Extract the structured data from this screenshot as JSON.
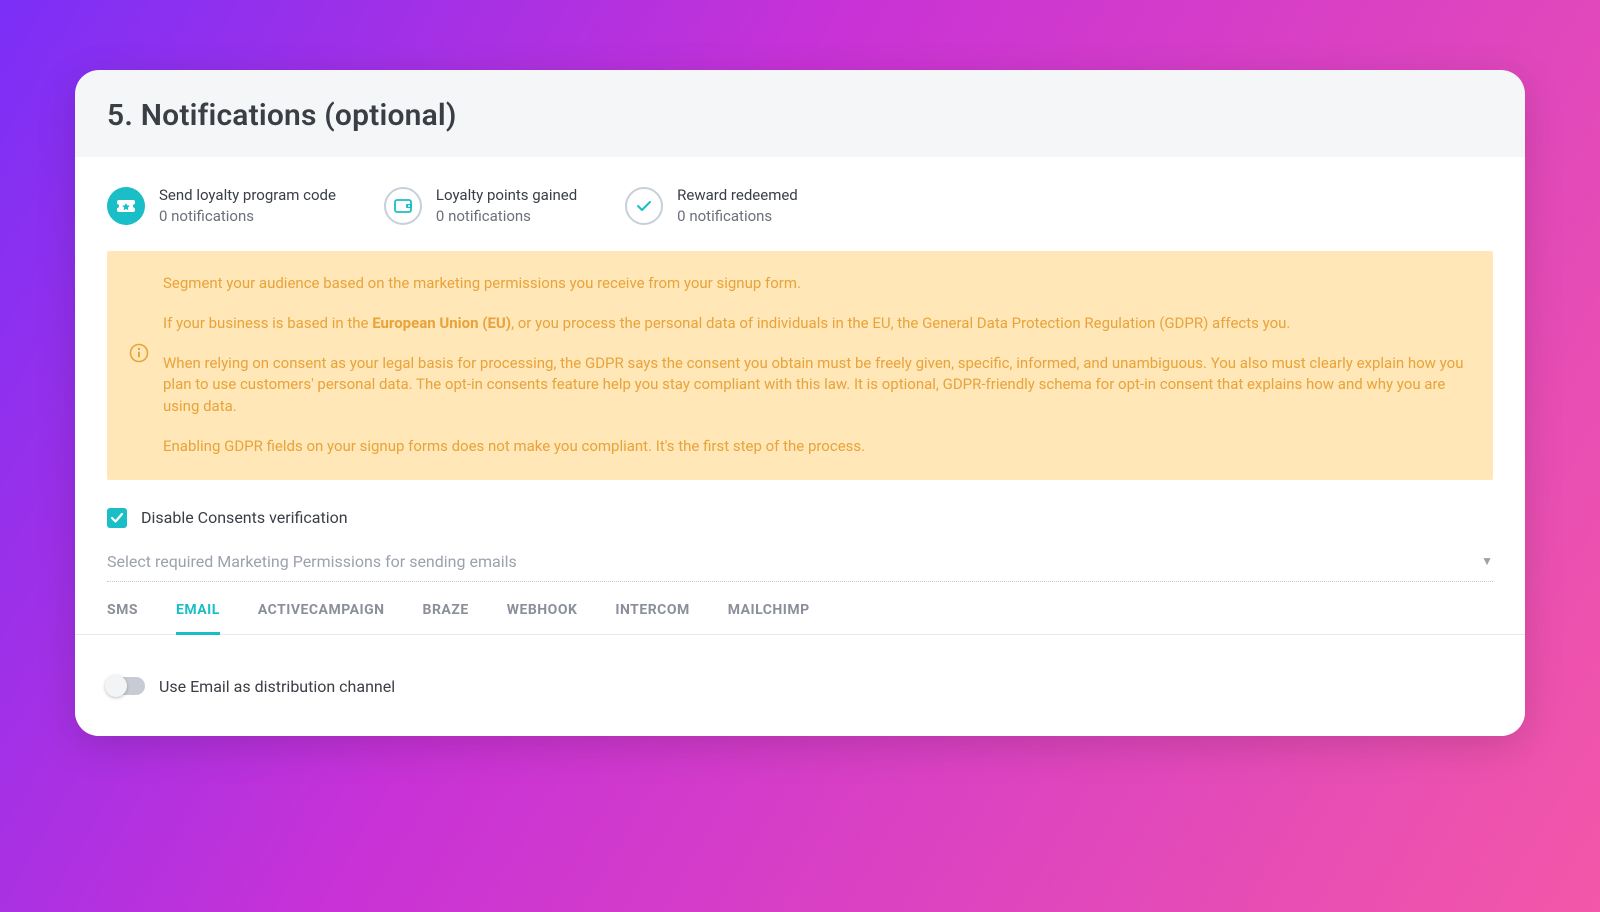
{
  "section": {
    "title": "5. Notifications (optional)"
  },
  "stats": [
    {
      "label": "Send loyalty program code",
      "value": "0 notifications",
      "icon": "ticket"
    },
    {
      "label": "Loyalty points gained",
      "value": "0 notifications",
      "icon": "wallet"
    },
    {
      "label": "Reward redeemed",
      "value": "0 notifications",
      "icon": "check"
    }
  ],
  "banner": {
    "p1": "Segment your audience based on the marketing permissions you receive from your signup form.",
    "p2_pre": "If your business is based in the ",
    "p2_strong": "European Union (EU)",
    "p2_post": ", or you process the personal data of individuals in the EU, the General Data Protection Regulation (GDPR) affects you.",
    "p3": "When relying on consent as your legal basis for processing, the GDPR says the consent you obtain must be freely given, specific, informed, and unambiguous. You also must clearly explain how you plan to use customers' personal data. The opt-in consents feature help you stay compliant with this law. It is optional, GDPR-friendly schema for opt-in consent that explains how and why you are using data.",
    "p4": "Enabling GDPR fields on your signup forms does not make you compliant. It's the first step of the process."
  },
  "checkbox": {
    "label": "Disable Consents verification",
    "checked": true
  },
  "select": {
    "placeholder": "Select required Marketing Permissions for sending emails"
  },
  "tabs": {
    "items": [
      "SMS",
      "EMAIL",
      "ACTIVECAMPAIGN",
      "BRAZE",
      "WEBHOOK",
      "INTERCOM",
      "MAILCHIMP"
    ],
    "active": "EMAIL"
  },
  "toggle": {
    "label": "Use Email as distribution channel",
    "on": false
  }
}
